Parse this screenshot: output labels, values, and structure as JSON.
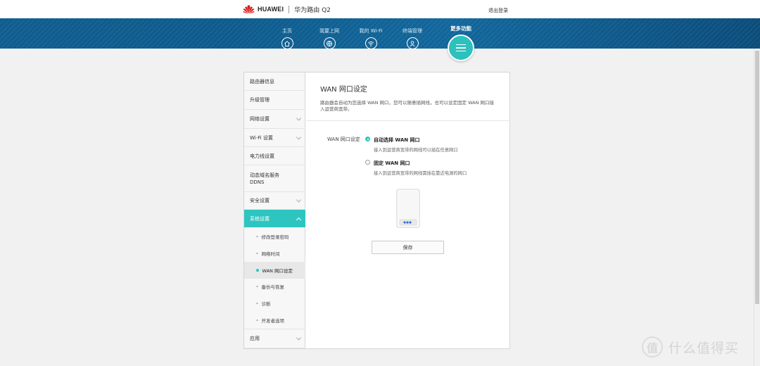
{
  "header": {
    "brand": "HUAWEI",
    "product": "华为路由 Q2",
    "logout": "退出登录"
  },
  "nav": {
    "items": [
      {
        "label": "主页",
        "icon": "home-icon"
      },
      {
        "label": "我要上网",
        "icon": "globe-icon"
      },
      {
        "label": "我的 Wi-Fi",
        "icon": "wifi-icon"
      },
      {
        "label": "终端管理",
        "icon": "user-icon"
      }
    ],
    "more_label": "更多功能",
    "more_icon": "menu-icon"
  },
  "sidebar": {
    "items": [
      {
        "label": "路由器信息",
        "expandable": false
      },
      {
        "label": "升级管理",
        "expandable": false
      },
      {
        "label": "网络设置",
        "expandable": true
      },
      {
        "label": "Wi-Fi 设置",
        "expandable": true
      },
      {
        "label": "电力线设置",
        "expandable": false
      },
      {
        "label": "动态域名服务",
        "label2": "DDNS",
        "expandable": false
      },
      {
        "label": "安全设置",
        "expandable": true
      },
      {
        "label": "系统设置",
        "expandable": true,
        "active": true
      },
      {
        "label": "应用",
        "expandable": true
      }
    ],
    "sub_items": [
      {
        "label": "修改登录密码"
      },
      {
        "label": "网络时间"
      },
      {
        "label": "WAN 网口设定",
        "current": true
      },
      {
        "label": "备份与恢复"
      },
      {
        "label": "诊断"
      },
      {
        "label": "开发者选项"
      }
    ]
  },
  "content": {
    "title": "WAN 网口设定",
    "description": "路由器会自动为您选择 WAN 网口，您可以随意插网线，也可以设定固定 WAN 网口接入运营商宽带。",
    "field_label": "WAN 网口设定",
    "options": [
      {
        "label": "自动选择 WAN 网口",
        "hint": "接入到运营商宽带的网线可以插在任意网口",
        "selected": true
      },
      {
        "label": "固定 WAN 网口",
        "hint": "接入到运营商宽带的网线需插在靠近电源的网口",
        "selected": false
      }
    ],
    "save_label": "保存"
  },
  "watermark": {
    "glyph": "值",
    "text": "什么值得买"
  },
  "colors": {
    "accent": "#2ec5c0",
    "nav_blue": "#0f5f92",
    "background": "#f1f1f1"
  }
}
